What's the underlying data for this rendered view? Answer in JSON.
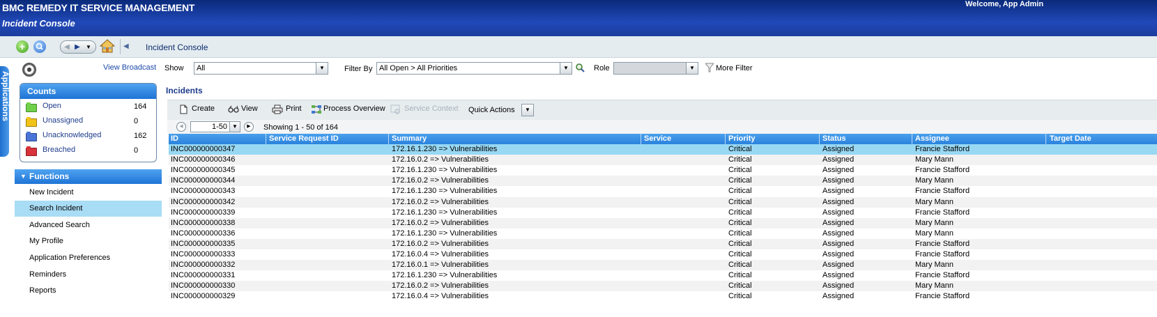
{
  "header": {
    "app_title": "BMC REMEDY IT SERVICE MANAGEMENT",
    "console_title": "Incident Console",
    "welcome": "Welcome,  App Admin"
  },
  "toolbar": {
    "breadcrumb": "Incident Console"
  },
  "apps_tab": {
    "label": "Applications"
  },
  "left": {
    "view_broadcast": "View Broadcast",
    "counts": {
      "title": "Counts",
      "items": [
        {
          "label": "Open",
          "value": "164",
          "color": "#6fd14a"
        },
        {
          "label": "Unassigned",
          "value": "0",
          "color": "#f2c318"
        },
        {
          "label": "Unacknowledged",
          "value": "162",
          "color": "#4a74d8"
        },
        {
          "label": "Breached",
          "value": "0",
          "color": "#d8323a"
        }
      ]
    },
    "functions": {
      "title": "Functions",
      "items": [
        {
          "label": "New Incident"
        },
        {
          "label": "Search Incident"
        },
        {
          "label": "Advanced Search"
        },
        {
          "label": "My Profile"
        },
        {
          "label": "Application Preferences"
        },
        {
          "label": "Reminders"
        },
        {
          "label": "Reports"
        }
      ]
    }
  },
  "filters": {
    "show_label": "Show",
    "show_value": "All",
    "filter_by_label": "Filter By",
    "filter_by_value": "All Open > All Priorities",
    "role_label": "Role",
    "role_value": "",
    "more_filter": "More Filter"
  },
  "incidents": {
    "title": "Incidents",
    "actions": {
      "create": "Create",
      "view": "View",
      "print": "Print",
      "process_overview": "Process Overview",
      "service_context": "Service Context",
      "quick_actions": "Quick Actions"
    },
    "pager": {
      "range": "1-50",
      "showing": "Showing 1 - 50 of 164"
    },
    "columns": [
      "ID",
      "Service Request ID",
      "Summary",
      "Service",
      "Priority",
      "Status",
      "Assignee",
      "Target Date"
    ],
    "rows": [
      {
        "id": "INC000000000347",
        "sr": "",
        "summary": "172.16.1.230 => Vulnerabilities",
        "service": "",
        "priority": "Critical",
        "status": "Assigned",
        "assignee": "Francie Stafford",
        "target": ""
      },
      {
        "id": "INC000000000346",
        "sr": "",
        "summary": "172.16.0.2 => Vulnerabilities",
        "service": "",
        "priority": "Critical",
        "status": "Assigned",
        "assignee": "Mary Mann",
        "target": ""
      },
      {
        "id": "INC000000000345",
        "sr": "",
        "summary": "172.16.1.230 => Vulnerabilities",
        "service": "",
        "priority": "Critical",
        "status": "Assigned",
        "assignee": "Francie Stafford",
        "target": ""
      },
      {
        "id": "INC000000000344",
        "sr": "",
        "summary": "172.16.0.2 => Vulnerabilities",
        "service": "",
        "priority": "Critical",
        "status": "Assigned",
        "assignee": "Mary Mann",
        "target": ""
      },
      {
        "id": "INC000000000343",
        "sr": "",
        "summary": "172.16.1.230 => Vulnerabilities",
        "service": "",
        "priority": "Critical",
        "status": "Assigned",
        "assignee": "Francie Stafford",
        "target": ""
      },
      {
        "id": "INC000000000342",
        "sr": "",
        "summary": "172.16.0.2 => Vulnerabilities",
        "service": "",
        "priority": "Critical",
        "status": "Assigned",
        "assignee": "Mary Mann",
        "target": ""
      },
      {
        "id": "INC000000000339",
        "sr": "",
        "summary": "172.16.1.230 => Vulnerabilities",
        "service": "",
        "priority": "Critical",
        "status": "Assigned",
        "assignee": "Francie Stafford",
        "target": ""
      },
      {
        "id": "INC000000000338",
        "sr": "",
        "summary": "172.16.0.2 => Vulnerabilities",
        "service": "",
        "priority": "Critical",
        "status": "Assigned",
        "assignee": "Mary Mann",
        "target": ""
      },
      {
        "id": "INC000000000336",
        "sr": "",
        "summary": "172.16.1.230 => Vulnerabilities",
        "service": "",
        "priority": "Critical",
        "status": "Assigned",
        "assignee": "Mary Mann",
        "target": ""
      },
      {
        "id": "INC000000000335",
        "sr": "",
        "summary": "172.16.0.2 => Vulnerabilities",
        "service": "",
        "priority": "Critical",
        "status": "Assigned",
        "assignee": "Francie Stafford",
        "target": ""
      },
      {
        "id": "INC000000000333",
        "sr": "",
        "summary": "172.16.0.4 => Vulnerabilities",
        "service": "",
        "priority": "Critical",
        "status": "Assigned",
        "assignee": "Francie Stafford",
        "target": ""
      },
      {
        "id": "INC000000000332",
        "sr": "",
        "summary": "172.16.0.1 => Vulnerabilities",
        "service": "",
        "priority": "Critical",
        "status": "Assigned",
        "assignee": "Mary Mann",
        "target": ""
      },
      {
        "id": "INC000000000331",
        "sr": "",
        "summary": "172.16.1.230 => Vulnerabilities",
        "service": "",
        "priority": "Critical",
        "status": "Assigned",
        "assignee": "Francie Stafford",
        "target": ""
      },
      {
        "id": "INC000000000330",
        "sr": "",
        "summary": "172.16.0.2 => Vulnerabilities",
        "service": "",
        "priority": "Critical",
        "status": "Assigned",
        "assignee": "Mary Mann",
        "target": ""
      },
      {
        "id": "INC000000000329",
        "sr": "",
        "summary": "172.16.0.4 => Vulnerabilities",
        "service": "",
        "priority": "Critical",
        "status": "Assigned",
        "assignee": "Francie Stafford",
        "target": ""
      }
    ]
  }
}
